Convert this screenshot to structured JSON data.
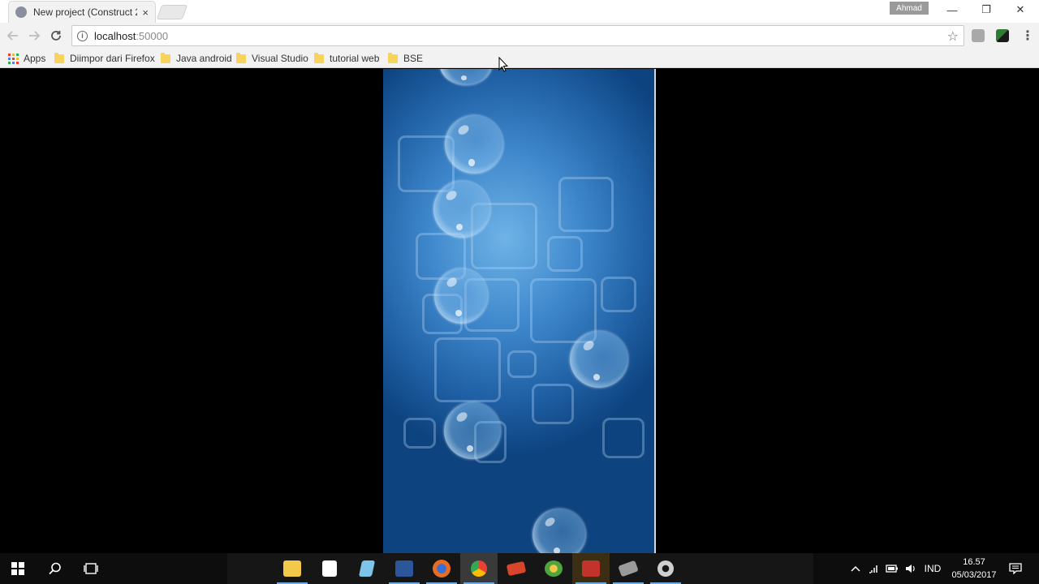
{
  "browser": {
    "tab": {
      "title": "New project (Construct 2",
      "close": "×"
    },
    "user_badge": "Ahmad",
    "window_controls": {
      "minimize": "—",
      "restore": "❐",
      "close": "✕"
    },
    "url": {
      "host": "localhost",
      "port": ":50000"
    },
    "bookmarks": [
      {
        "label": "Apps",
        "icon": "apps-grid-icon"
      },
      {
        "label": "Diimpor dari Firefox",
        "icon": "folder-icon"
      },
      {
        "label": "Java android",
        "icon": "folder-icon"
      },
      {
        "label": "Visual Studio",
        "icon": "folder-icon"
      },
      {
        "label": "tutorial web",
        "icon": "folder-icon"
      },
      {
        "label": "BSE",
        "icon": "folder-icon"
      }
    ]
  },
  "game": {
    "background_colors": [
      "#6fb3e6",
      "#1f5fa3",
      "#0d437f"
    ],
    "bubble_count": 8
  },
  "taskbar": {
    "apps": [
      {
        "name": "file-explorer",
        "color": "#f3c84b",
        "running": true
      },
      {
        "name": "store",
        "color": "#ffffff",
        "running": false
      },
      {
        "name": "notepad",
        "color": "#7ec3e8",
        "running": false
      },
      {
        "name": "word",
        "color": "#2b579a",
        "running": true
      },
      {
        "name": "firefox",
        "color": "#e76d21",
        "running": true
      },
      {
        "name": "chrome",
        "color": "#3b9b4a",
        "running": true,
        "focused": true
      },
      {
        "name": "ebook-reader",
        "color": "#d9452b",
        "running": false
      },
      {
        "name": "network-tool",
        "color": "#4fa53b",
        "running": false
      },
      {
        "name": "construct-2",
        "color": "#c2332b",
        "running": true
      },
      {
        "name": "cert-tool",
        "color": "#9a9a9a",
        "running": true
      },
      {
        "name": "settings",
        "color": "#cfcfcf",
        "running": true
      }
    ],
    "tray": {
      "language": "IND"
    },
    "clock": {
      "time": "16.57",
      "date": "05/03/2017"
    }
  }
}
